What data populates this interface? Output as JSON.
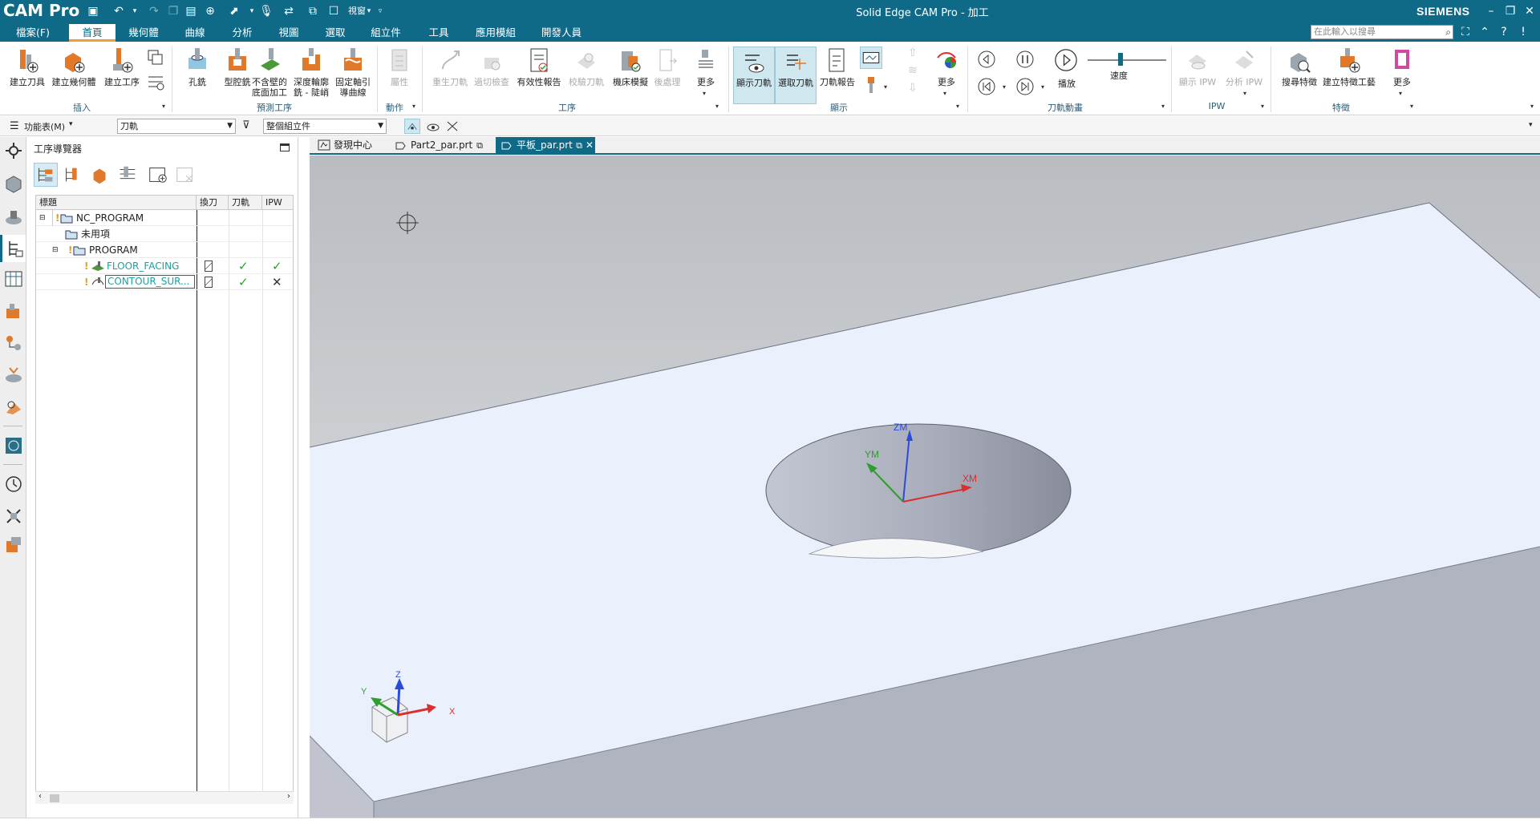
{
  "app": {
    "brand": "CAM Pro",
    "window_title": "Solid Edge CAM Pro - 加工",
    "vendor": "SIEMENS",
    "qa_window_label": "視窗"
  },
  "menu": {
    "tabs": [
      "檔案(F)",
      "首頁",
      "幾何體",
      "曲線",
      "分析",
      "視圖",
      "選取",
      "組立件",
      "工具",
      "應用模組",
      "開發人員"
    ],
    "active_index": 1,
    "search_placeholder": "在此輸入以搜尋"
  },
  "ribbon": {
    "insert": {
      "group": "插入",
      "create_tool": "建立刀具",
      "create_geometry": "建立幾何體",
      "create_operation": "建立工序"
    },
    "predefined": {
      "group": "預測工序",
      "hole_milling": "孔銑",
      "cavity_mill": "型腔銑",
      "floor_wall_1": "不含壁的",
      "floor_wall_2": "底面加工",
      "zlevel_1": "深度輪廓",
      "zlevel_2": "銑 - 陡峭",
      "fixed_1": "固定軸引",
      "fixed_2": "導曲線"
    },
    "actions": {
      "group": "動作",
      "properties": "屬性"
    },
    "operation": {
      "group": "工序",
      "regenerate": "重生刀軌",
      "verify_tool": "過切檢查",
      "validity_report": "有效性報告",
      "verify_path": "校驗刀軌",
      "machine_sim": "機床模擬",
      "postprocess": "後處理",
      "more": "更多"
    },
    "display": {
      "group": "顯示",
      "show_toolpath": "顯示刀軌",
      "select_toolpath": "選取刀軌",
      "toolpath_report": "刀軌報告",
      "more": "更多"
    },
    "animation": {
      "group": "刀軌動畫",
      "play": "播放",
      "speed": "速度"
    },
    "ipw": {
      "group": "IPW",
      "show_ipw": "顯示 IPW",
      "analyze_ipw": "分析 IPW"
    },
    "feature": {
      "group": "特徵",
      "find_feature": "搜尋特徵",
      "create_feature_process": "建立特徵工藝",
      "more": "更多"
    }
  },
  "toolbar2": {
    "menu_label": "功能表(M)",
    "filter_value": "刀軌",
    "scope_value": "整個組立件"
  },
  "navigator": {
    "title": "工序導覽器",
    "columns": [
      "標題",
      "換刀",
      "刀軌",
      "IPW"
    ],
    "rows": [
      {
        "label": "NC_PROGRAM"
      },
      {
        "label": "未用項"
      },
      {
        "label": "PROGRAM"
      },
      {
        "label": "FLOOR_FACING",
        "toolpath": "✓",
        "ipw": "✓"
      },
      {
        "label": "CONTOUR_SUR...",
        "toolpath": "✓",
        "ipw": "✕"
      }
    ]
  },
  "doc_tabs": [
    "發現中心",
    "Part2_par.prt",
    "平板_par.prt"
  ],
  "viewport": {
    "wcs_labels": {
      "z": "ZM",
      "y": "YM",
      "x": "XM"
    },
    "triad_labels": {
      "z": "Z",
      "y": "Y",
      "x": "X"
    }
  },
  "colors": {
    "titlebar": "#0f6a88",
    "accent": "#f0a030",
    "check": "#2e9e2e",
    "face_top": "#eaf1fc",
    "background_top": "#b9bcc0"
  }
}
